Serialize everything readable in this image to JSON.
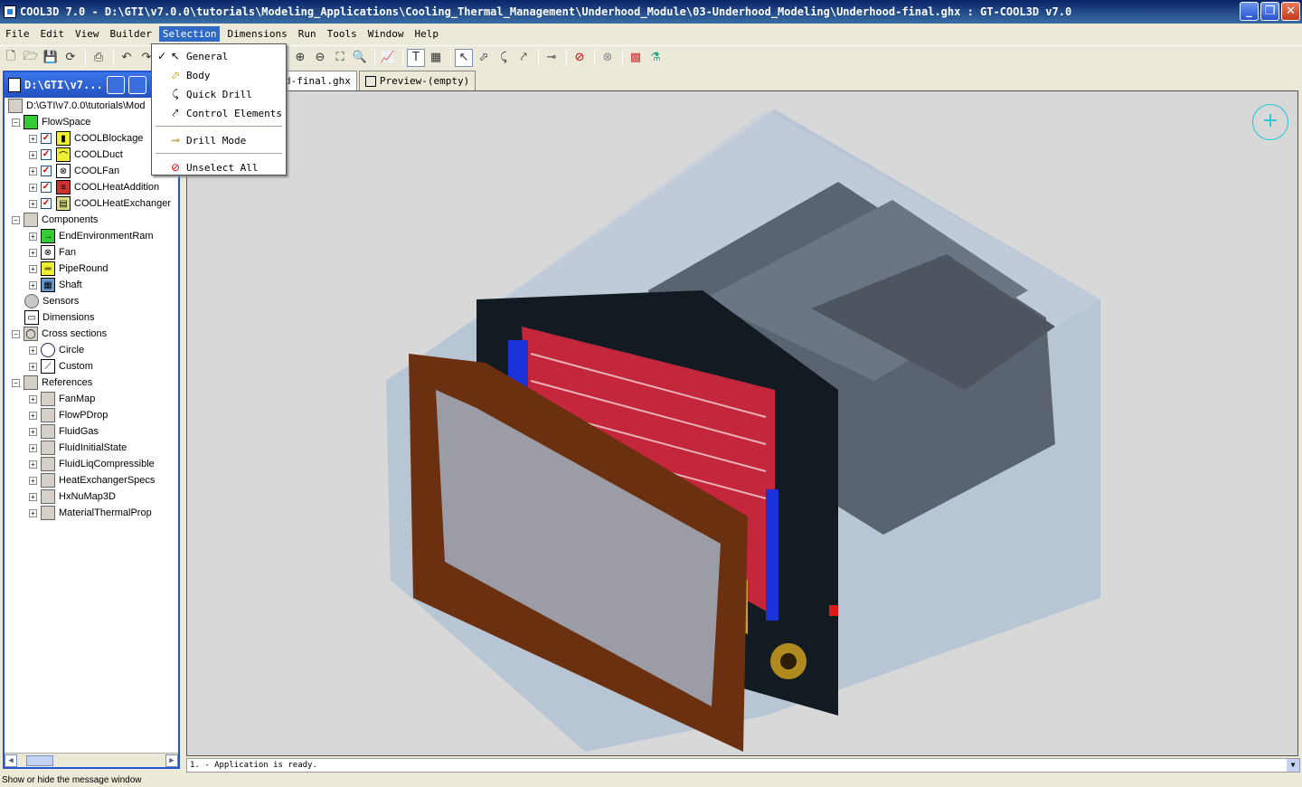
{
  "window": {
    "title": "COOL3D 7.0 - D:\\GTI\\v7.0.0\\tutorials\\Modeling_Applications\\Cooling_Thermal_Management\\Underhood_Module\\03-Underhood_Modeling\\Underhood-final.ghx : GT-COOL3D v7.0"
  },
  "menu": [
    "File",
    "Edit",
    "View",
    "Builder",
    "Selection",
    "Dimensions",
    "Run",
    "Tools",
    "Window",
    "Help"
  ],
  "selection_menu": {
    "items": [
      {
        "label": "General",
        "checked": true,
        "icon": "cursor-icon"
      },
      {
        "label": "Body",
        "icon": "body-select-icon"
      },
      {
        "label": "Quick Drill",
        "icon": "quick-drill-icon"
      },
      {
        "label": "Control Elements",
        "icon": "control-elements-icon"
      },
      {
        "label": "Drill Mode",
        "icon": "drill-mode-icon"
      },
      {
        "label": "Unselect All",
        "icon": "unselect-icon"
      }
    ]
  },
  "left_panel": {
    "title": "D:\\GTI\\v7...",
    "root": "D:\\GTI\\v7.0.0\\tutorials\\Mod",
    "tree": {
      "flowspace": "FlowSpace",
      "flowspace_items": [
        "COOLBlockage",
        "COOLDuct",
        "COOLFan",
        "COOLHeatAddition",
        "COOLHeatExchanger"
      ],
      "components": "Components",
      "components_items": [
        "EndEnvironmentRam",
        "Fan",
        "PipeRound",
        "Shaft"
      ],
      "sensors": "Sensors",
      "dimensions": "Dimensions",
      "cross_sections": "Cross sections",
      "cross_items": [
        "Circle",
        "Custom"
      ],
      "references": "References",
      "ref_items": [
        "FanMap",
        "FlowPDrop",
        "FluidGas",
        "FluidInitialState",
        "FluidLiqCompressible",
        "HeatExchangerSpecs",
        "HxNuMap3D",
        "MaterialThermalProp"
      ]
    }
  },
  "tabs": [
    {
      "label": "d-final.ghx",
      "active": true
    },
    {
      "label": "Preview-(empty)",
      "active": false
    }
  ],
  "message": "1. - Application is ready.",
  "status": "Show or hide the message window",
  "colors": {
    "title_blue": "#0a246a",
    "accent": "#316ac5",
    "viewport_bg": "#d8d8d8",
    "zoom_icon": "#21c6d9"
  }
}
